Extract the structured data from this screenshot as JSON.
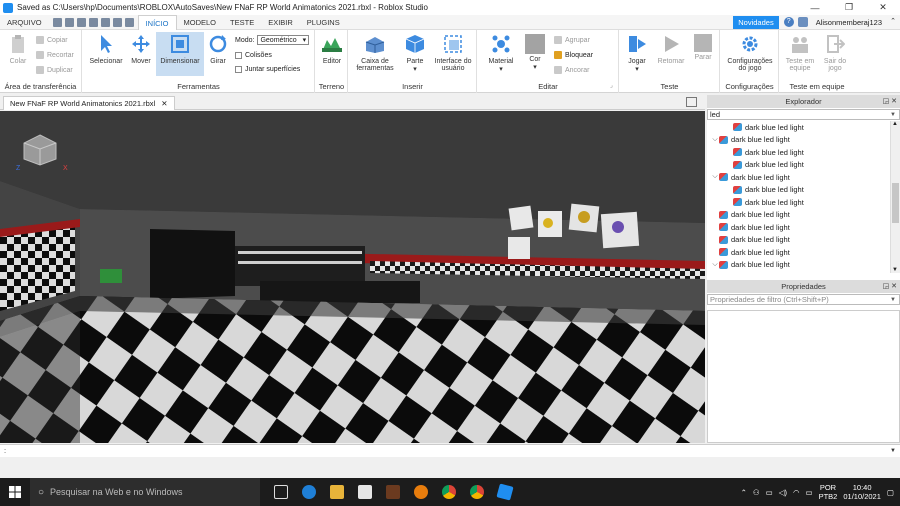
{
  "window": {
    "title": "Saved as C:\\Users\\hp\\Documents\\ROBLOX\\AutoSaves\\New FNaF RP World Animatonics 2021.rbxl - Roblox Studio",
    "minimize": "—",
    "restore": "❐",
    "close": "✕"
  },
  "menubar": {
    "file": "ARQUIVO",
    "tabs": [
      "INÍCIO",
      "MODELO",
      "TESTE",
      "EXIBIR",
      "PLUGINS"
    ],
    "novidades": "Novidades",
    "help": "?",
    "user": "Alisonmemberaj123"
  },
  "ribbon": {
    "clipboard": {
      "label": "Área de transferência",
      "paste": "Colar",
      "copy": "Copiar",
      "cut": "Recortar",
      "duplicate": "Duplicar"
    },
    "tools": {
      "label": "Ferramentas",
      "select": "Selecionar",
      "move": "Mover",
      "scale": "Dimensionar",
      "rotate": "Girar",
      "mode_label": "Modo:",
      "mode_value": "Geométrico",
      "collisions": "Colisões",
      "join": "Juntar superfícies"
    },
    "terrain": {
      "label": "Terreno",
      "editor": "Editor"
    },
    "insert": {
      "label": "Inserir",
      "toolbox": "Caixa de ferramentas",
      "part": "Parte",
      "ui": "Interface do usuário"
    },
    "edit": {
      "label": "Editar",
      "material": "Material",
      "color": "Cor",
      "group": "Agrupar",
      "lock": "Bloquear",
      "anchor": "Ancorar"
    },
    "test": {
      "label": "Teste",
      "play": "Jogar",
      "resume": "Retomar",
      "stop": "Parar"
    },
    "settings": {
      "label": "Configurações",
      "game_settings": "Configurações do jogo"
    },
    "team_test": {
      "label": "Teste em equipe",
      "team_test": "Teste em equipe",
      "exit_game": "Sair do jogo"
    }
  },
  "document": {
    "tab": "New FNaF RP World Animatonics 2021.rbxl",
    "close": "✕"
  },
  "explorer": {
    "title": "Explorador",
    "filter_value": "led",
    "items": [
      {
        "label": "dark blue led light",
        "indent": 1,
        "arrow": ""
      },
      {
        "label": "dark blue led light",
        "indent": 0,
        "arrow": "⌵"
      },
      {
        "label": "dark blue led light",
        "indent": 1,
        "arrow": ""
      },
      {
        "label": "dark blue led light",
        "indent": 1,
        "arrow": ""
      },
      {
        "label": "dark blue led light",
        "indent": 0,
        "arrow": "⌵"
      },
      {
        "label": "dark blue led light",
        "indent": 1,
        "arrow": ""
      },
      {
        "label": "dark blue led light",
        "indent": 1,
        "arrow": ""
      },
      {
        "label": "dark blue led light",
        "indent": 0,
        "arrow": ""
      },
      {
        "label": "dark blue led light",
        "indent": 0,
        "arrow": ""
      },
      {
        "label": "dark blue led light",
        "indent": 0,
        "arrow": ""
      },
      {
        "label": "dark blue led light",
        "indent": 0,
        "arrow": ""
      },
      {
        "label": "dark blue led light",
        "indent": 0,
        "arrow": "⌵"
      }
    ]
  },
  "properties": {
    "title": "Propriedades",
    "filter_placeholder": "Propriedades de filtro (Ctrl+Shift+P)"
  },
  "viewcube": {
    "x": "X",
    "z": "Z"
  },
  "command_bar": {
    "value": ":"
  },
  "taskbar": {
    "search_placeholder": "Pesquisar na Web e no Windows",
    "lang1": "POR",
    "lang2": "PTB2",
    "time": "10:40",
    "date": "01/10/2021"
  },
  "colors": {
    "accent": "#1f8ef0",
    "selected_tool": "#c8ddf2",
    "floor_dark": "#0c0c0c",
    "floor_light": "#dcdcdc",
    "wall_red": "#9a1a1a"
  }
}
